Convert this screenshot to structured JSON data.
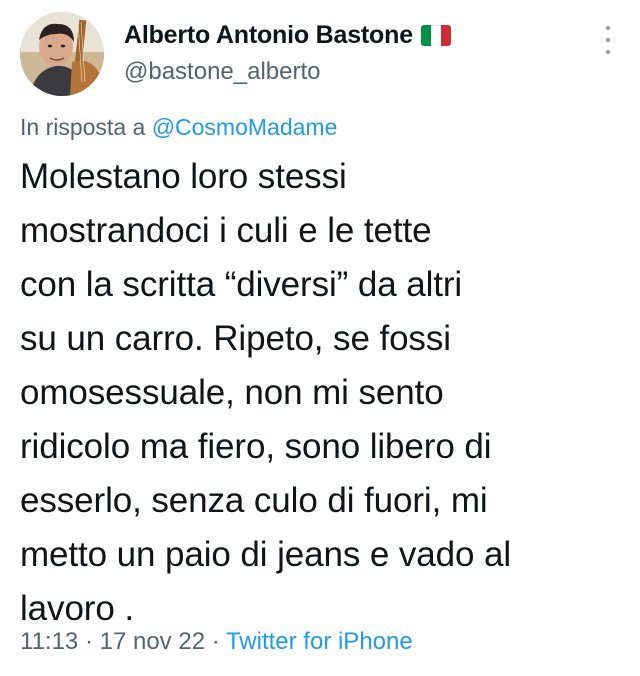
{
  "tweet": {
    "author": {
      "display_name": "Alberto Antonio Bastone",
      "flag_icon": "flag-italy-icon",
      "flag_colors": [
        "#009246",
        "#ffffff",
        "#ce2b37"
      ],
      "handle": "@bastone_alberto"
    },
    "more_icon": "more-vertical-icon",
    "reply": {
      "prefix": "In risposta a",
      "mention": "@CosmoMadame"
    },
    "text": "Molestano loro stessi\nmostrandoci i culi e le tette\ncon la scritta “diversi” da altri\nsu un carro. Ripeto, se fossi\nomosessuale, non mi sento\nridicolo ma fiero, sono libero di\nesserlo, senza culo di fuori, mi\nmetto un paio di jeans e vado al\nlavoro .",
    "time": "11:13",
    "date": "17 nov 22",
    "separator": "·",
    "source": "Twitter for iPhone"
  },
  "colors": {
    "text": "#0f1419",
    "secondary": "#536471",
    "link": "#1d9bf0"
  }
}
